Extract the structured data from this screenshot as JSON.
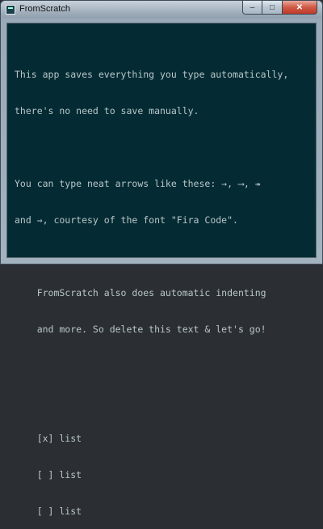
{
  "window": {
    "title": "FromScratch",
    "controls": {
      "minimize": "–",
      "maximize": "□",
      "close": "✕"
    }
  },
  "editor": {
    "lines": [
      "This app saves everything you type automatically,",
      "there's no need to save manually.",
      "",
      "You can type neat arrows like these: →, ⟶, ↠",
      "and ⇒, courtesy of the font \"Fira Code\".",
      "",
      "    FromScratch also does automatic indenting",
      "    and more. So delete this text & let's go!",
      "",
      "",
      "    [x] list",
      "    [ ] list",
      "    [ ] list"
    ]
  },
  "colors": {
    "editor_background": "#042b33",
    "editor_text": "#b9c6c9",
    "titlebar": "#a9b7c4",
    "close_button": "#c0392b"
  }
}
